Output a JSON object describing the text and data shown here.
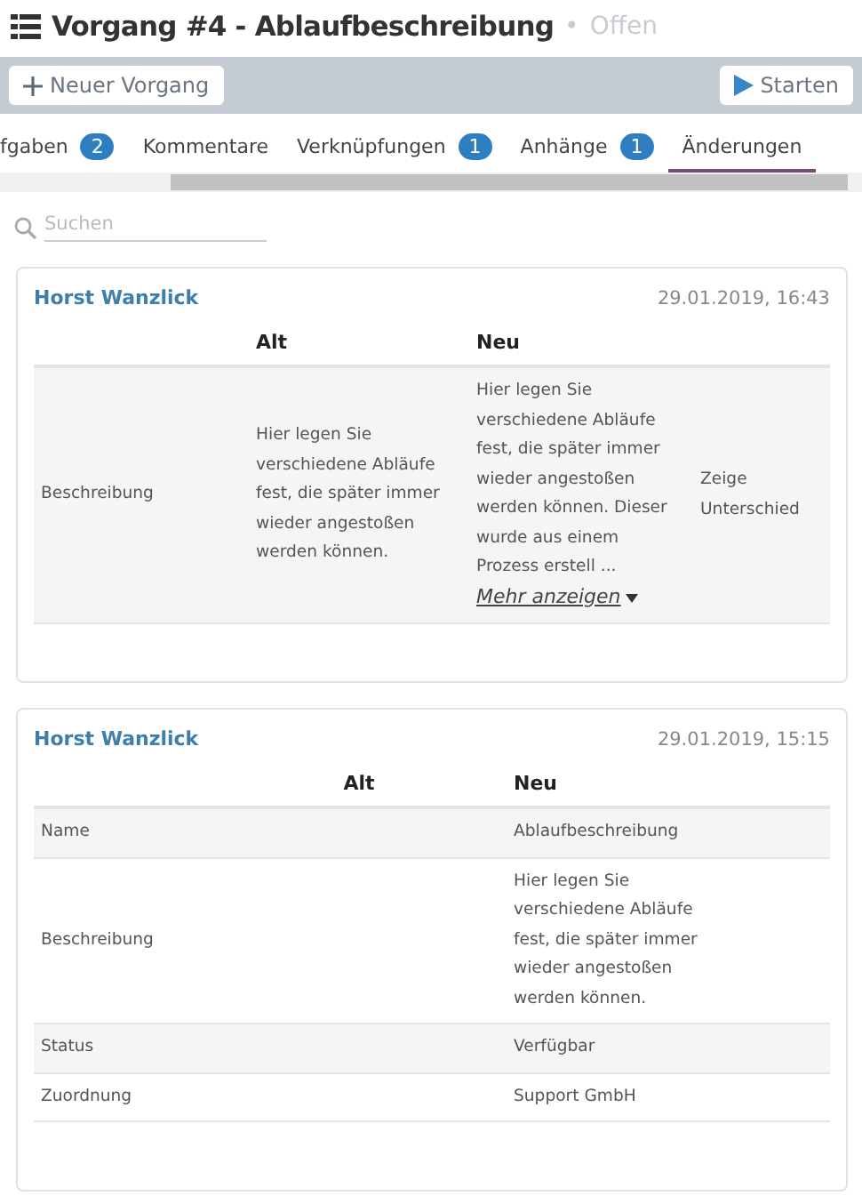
{
  "header": {
    "title": "Vorgang #4 - Ablaufbeschreibung",
    "separator": "•",
    "status": "Offen"
  },
  "toolbar": {
    "new_button": "Neuer Vorgang",
    "start_button": "Starten"
  },
  "tabs": [
    {
      "label": "fgaben",
      "badge": "2",
      "selected": false
    },
    {
      "label": "Kommentare",
      "selected": false
    },
    {
      "label": "Verknüpfungen",
      "badge": "1",
      "selected": false
    },
    {
      "label": "Anhänge",
      "badge": "1",
      "selected": false
    },
    {
      "label": "Änderungen",
      "selected": true
    }
  ],
  "search": {
    "placeholder": "Suchen"
  },
  "changes": [
    {
      "author": "Horst Wanzlick",
      "time": "29.01.2019, 16:43",
      "columns": [
        "Alt",
        "Neu"
      ],
      "rows": [
        {
          "field": "Beschreibung",
          "old": "Hier legen Sie verschiedene Abläufe fest, die später immer wieder angestoßen werden können.",
          "new": "Hier legen Sie verschiedene Abläufe fest, die später immer wieder angestoßen werden können. Dieser wurde aus einem Prozess erstell",
          "ellipsis": "...",
          "more": "Mehr anzeigen",
          "diff": "Zeige Unterschied"
        }
      ]
    },
    {
      "author": "Horst Wanzlick",
      "time": "29.01.2019, 15:15",
      "columns": [
        "Alt",
        "Neu"
      ],
      "rows": [
        {
          "field": "Name",
          "new": "Ablaufbeschreibung"
        },
        {
          "field": "Beschreibung",
          "new": "Hier legen Sie verschiedene Abläufe fest, die später immer wieder angestoßen werden können."
        },
        {
          "field": "Status",
          "new": "Verfügbar"
        },
        {
          "field": "Zuordnung",
          "new": "Support GmbH"
        }
      ]
    }
  ]
}
